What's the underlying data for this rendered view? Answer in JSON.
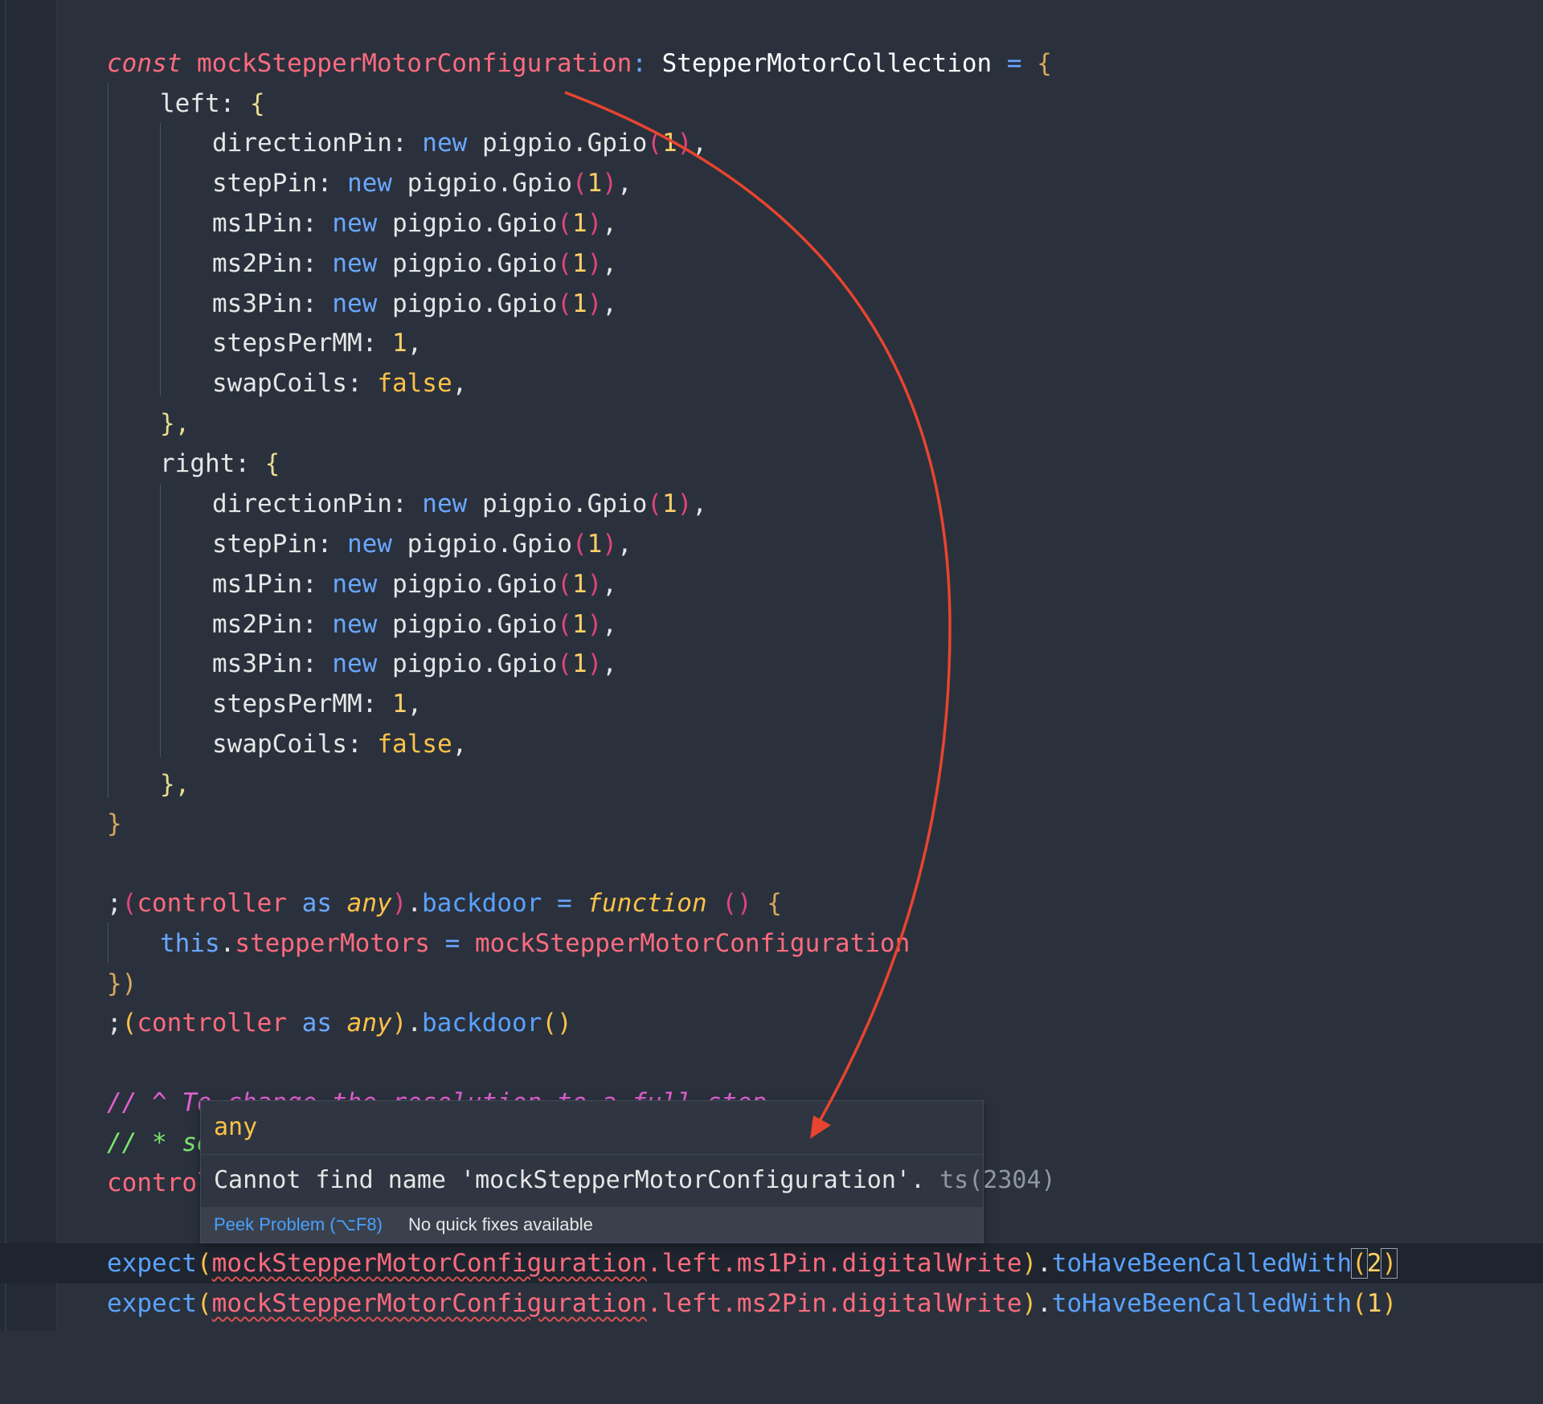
{
  "editor": {
    "lines": {
      "l1": {
        "const_kw": "const",
        "var_name": "mockStepperMotorConfiguration",
        "colon": ":",
        "type_name": "StepperMotorCollection",
        "eq": "=",
        "open_brace": "{"
      },
      "left_key": "left: ",
      "right_key": "right: ",
      "obj_open": "{",
      "obj_close": "},",
      "final_close": "}",
      "pins": [
        {
          "key": "directionPin: ",
          "new": "new",
          "call": " pigpio.Gpio",
          "arg": "1"
        },
        {
          "key": "stepPin: ",
          "new": "new",
          "call": " pigpio.Gpio",
          "arg": "1"
        },
        {
          "key": "ms1Pin: ",
          "new": "new",
          "call": " pigpio.Gpio",
          "arg": "1"
        },
        {
          "key": "ms2Pin: ",
          "new": "new",
          "call": " pigpio.Gpio",
          "arg": "1"
        },
        {
          "key": "ms3Pin: ",
          "new": "new",
          "call": " pigpio.Gpio",
          "arg": "1"
        }
      ],
      "steps_key": "stepsPerMM: ",
      "steps_val": "1",
      "swap_key": "swapCoils: ",
      "swap_val": "false",
      "backdoor_def": {
        "semi": ";",
        "controller": "controller",
        "as": "as",
        "any": "any",
        "prop": "backdoor",
        "eq": "=",
        "function_kw": "function",
        "parens": "()",
        "brace": "{"
      },
      "this_line": {
        "this": "this",
        "prop": "stepperMotors",
        "eq": "=",
        "value": "mockStepperMotorConfiguration"
      },
      "backdoor_close": "})",
      "backdoor_call": {
        "semi": ";",
        "controller": "controller",
        "as": "as",
        "any": "any",
        "prop": "backdoor",
        "parens": "()"
      },
      "comment1": "// ^ To change the resolution to a full step",
      "comment2": "// * se",
      "control_partial": "control",
      "expect1": {
        "expect": "expect",
        "target": "mockStepperMotorConfiguration",
        "path": ".left.ms1Pin.digitalWrite",
        "method": "toHaveBeenCalledWith",
        "arg": "2"
      },
      "expect2": {
        "expect": "expect",
        "target": "mockStepperMotorConfiguration",
        "path": ".left.ms2Pin.digitalWrite",
        "method": "toHaveBeenCalledWith",
        "arg": "1"
      }
    }
  },
  "hover": {
    "type": "any",
    "message": "Cannot find name 'mockStepperMotorConfiguration'.",
    "code": "ts(2304)",
    "peek_label": "Peek Problem (⌥F8)",
    "no_fix_label": "No quick fixes available"
  },
  "annotation": {
    "arrow_color": "#e8442f"
  }
}
